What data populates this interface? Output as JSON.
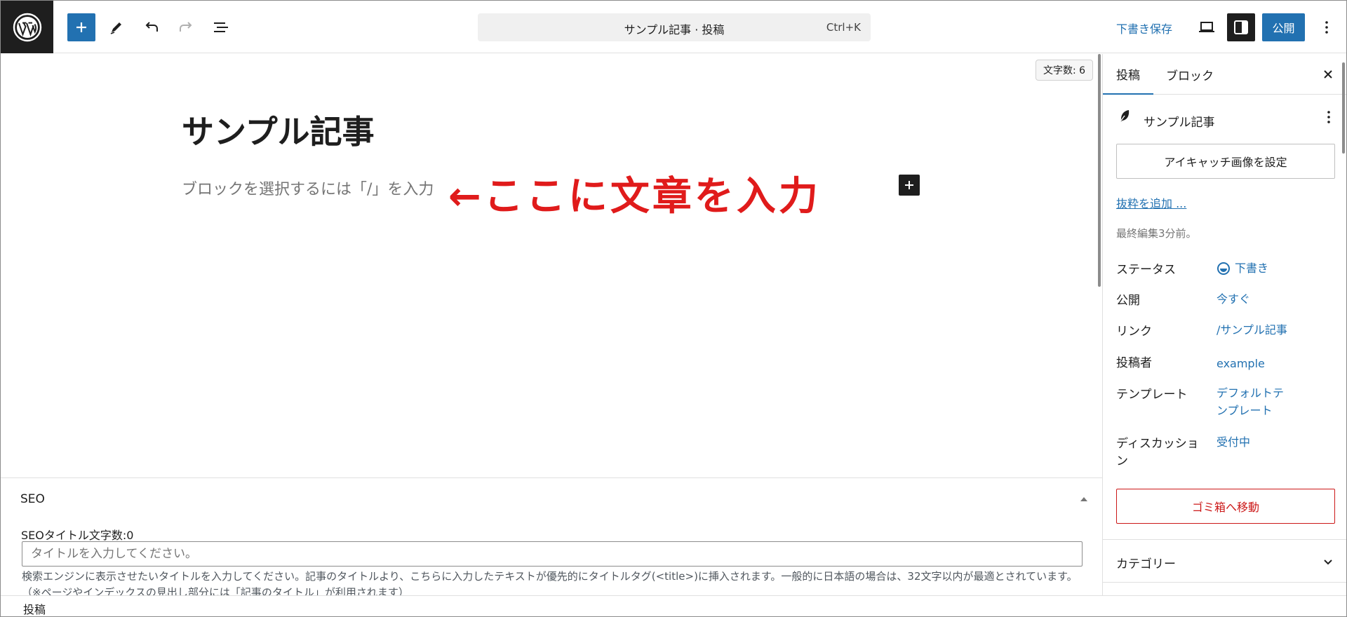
{
  "topbar": {
    "command_title": "サンプル記事 · 投稿",
    "command_shortcut": "Ctrl+K",
    "save_draft": "下書き保存",
    "publish": "公開",
    "icons": [
      "wordpress-logo",
      "plus-icon",
      "pencil-icon",
      "undo-icon",
      "redo-icon",
      "list-view-icon",
      "preview-icon",
      "sidebar-icon",
      "more-vertical-icon"
    ],
    "accent": "#2271b1"
  },
  "canvas": {
    "word_count": "文字数: 6",
    "post_title": "サンプル記事",
    "block_placeholder": "ブロックを選択するには「/」を入力",
    "annotation": "←ここに文章を入力",
    "annotation_color": "#e01b1b"
  },
  "seo": {
    "heading": "SEO",
    "title_count": "SEOタイトル文字数:0",
    "title_placeholder": "タイトルを入力してください。",
    "description": "検索エンジンに表示させたいタイトルを入力してください。記事のタイトルより、こちらに入力したテキストが優先的にタイトルタグ(<title>)に挿入されます。一般的に日本語の場合は、32文字以内が最適とされています。（※ページやインデックスの見出し部分には「記事のタイトル」が利用されます）"
  },
  "footer": {
    "breadcrumb": "投稿"
  },
  "sidebar": {
    "tab_post": "投稿",
    "tab_block": "ブロック",
    "post_title": "サンプル記事",
    "featured_image": "アイキャッチ画像を設定",
    "add_excerpt": "抜粋を追加 ...",
    "last_edited": "最終編集3分前。",
    "rows": {
      "status_label": "ステータス",
      "status_value": "下書き",
      "publish_label": "公開",
      "publish_value": "今すぐ",
      "link_label": "リンク",
      "link_value": "/サンプル記事",
      "author_label": "投稿者",
      "author_value": "example",
      "template_label": "テンプレート",
      "template_value": "デフォルトテンプレート",
      "discussion_label": "ディスカッション",
      "discussion_value": "受付中"
    },
    "trash": "ゴミ箱へ移動",
    "categories": "カテゴリー",
    "danger_color": "#cc1818"
  }
}
